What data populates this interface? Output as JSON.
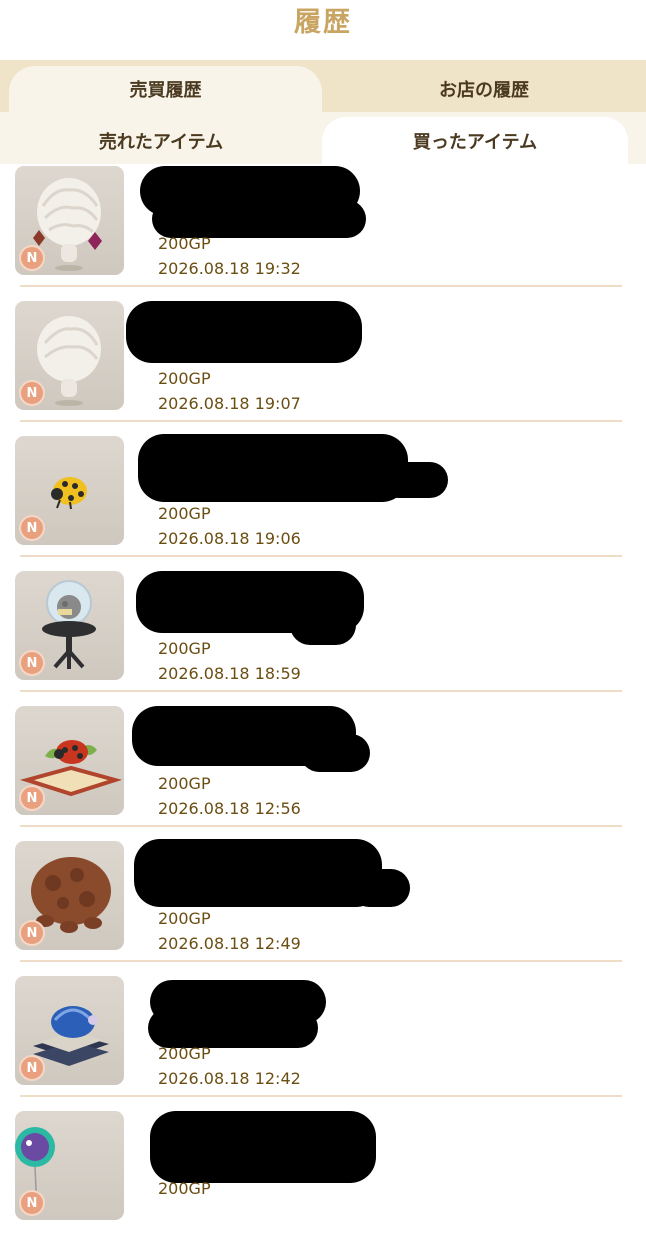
{
  "header": {
    "title": "履歴"
  },
  "tabs_main": [
    {
      "label": "売買履歴",
      "active": true
    },
    {
      "label": "お店の履歴",
      "active": false
    }
  ],
  "tabs_sub": [
    {
      "label": "売れたアイテム",
      "active": false
    },
    {
      "label": "買ったアイテム",
      "active": true
    }
  ],
  "items": [
    {
      "icon": "wig-earrings",
      "rarity": "N",
      "price": "200GP",
      "date": "2026.08.18 19:32"
    },
    {
      "icon": "wig",
      "rarity": "N",
      "price": "200GP",
      "date": "2026.08.18 19:07"
    },
    {
      "icon": "yellow-ladybug",
      "rarity": "N",
      "price": "200GP",
      "date": "2026.08.18 19:06"
    },
    {
      "icon": "moon-globe-table",
      "rarity": "N",
      "price": "200GP",
      "date": "2026.08.18 18:59"
    },
    {
      "icon": "ladybug-book",
      "rarity": "N",
      "price": "200GP",
      "date": "2026.08.18 12:56"
    },
    {
      "icon": "brown-bug",
      "rarity": "N",
      "price": "200GP",
      "date": "2026.08.18 12:49"
    },
    {
      "icon": "blue-beetle-books",
      "rarity": "N",
      "price": "200GP",
      "date": "2026.08.18 12:42"
    },
    {
      "icon": "balloon",
      "rarity": "N",
      "price": "200GP",
      "date": ""
    }
  ],
  "colors": {
    "title": "#c9a563",
    "tab_bar": "#efe4c8",
    "tab_active": "#f8f4ea",
    "text": "#6b4e12",
    "divider": "#efdcc6",
    "rarity_badge": "#e9a07f"
  }
}
